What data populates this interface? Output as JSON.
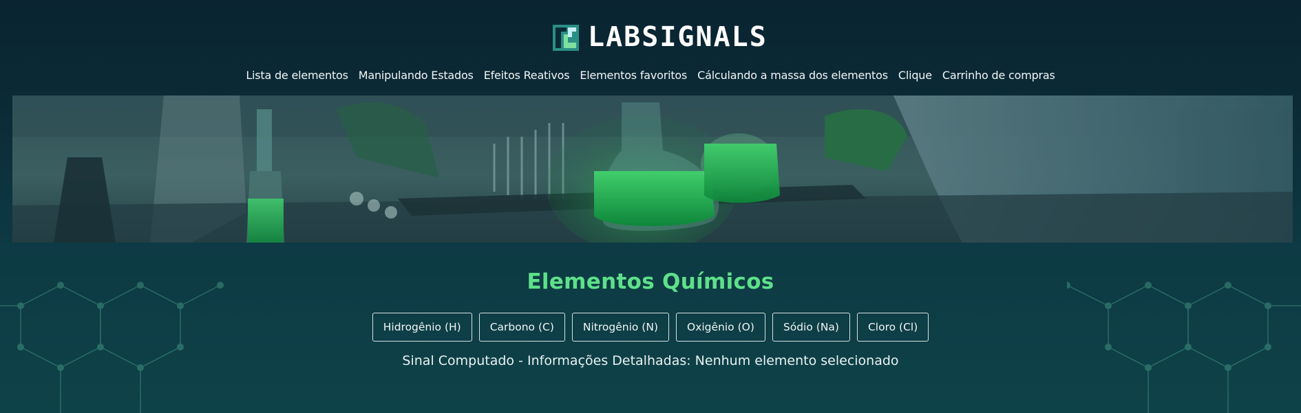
{
  "brand": {
    "name": "LABSIGNALS",
    "logo_colors": {
      "primary": "#2fbf71",
      "secondary": "#8fd3e8"
    }
  },
  "nav": {
    "items": [
      {
        "label": "Lista de elementos"
      },
      {
        "label": "Manipulando Estados"
      },
      {
        "label": "Efeitos Reativos"
      },
      {
        "label": "Elementos favoritos"
      },
      {
        "label": "Cálculando a massa dos elementos"
      },
      {
        "label": "Clique"
      },
      {
        "label": "Carrinho de compras"
      }
    ]
  },
  "hero": {
    "description_icon": "laboratory-banner-image"
  },
  "main": {
    "title": "Elementos Químicos",
    "elements": [
      {
        "label": "Hidrogênio (H)"
      },
      {
        "label": "Carbono (C)"
      },
      {
        "label": "Nitrogênio (N)"
      },
      {
        "label": "Oxigênio (O)"
      },
      {
        "label": "Sódio (Na)"
      },
      {
        "label": "Cloro (Cl)"
      }
    ],
    "status": "Sinal Computado - Informações Detalhadas: Nenhum elemento selecionado"
  },
  "colors": {
    "accent": "#5ee08a",
    "background": "#0b2a36",
    "text": "#ffffff"
  }
}
